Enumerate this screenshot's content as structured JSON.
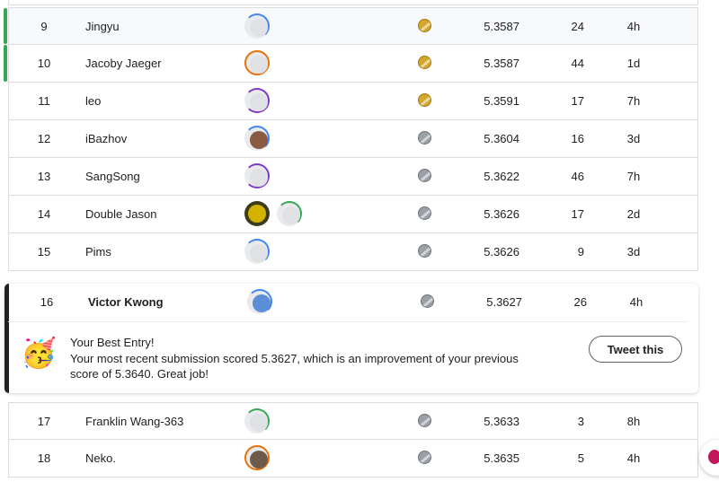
{
  "rows_top": [
    {
      "rank": "9",
      "name": "Jingyu",
      "medal": "gold",
      "score": "5.3587",
      "entries": "24",
      "last": "4h",
      "team_avatars": 1,
      "highlight": true,
      "indicator": "green",
      "ring": "blue"
    },
    {
      "rank": "10",
      "name": "Jacoby Jaeger",
      "medal": "gold",
      "score": "5.3587",
      "entries": "44",
      "last": "1d",
      "highlight": false,
      "indicator": "green",
      "ring": "orange"
    },
    {
      "rank": "11",
      "name": "leo",
      "medal": "gold",
      "score": "5.3591",
      "entries": "17",
      "last": "7h",
      "ring": "purple"
    },
    {
      "rank": "12",
      "name": "iBazhov",
      "medal": "silver",
      "score": "5.3604",
      "entries": "16",
      "last": "3d",
      "ring": "blue"
    },
    {
      "rank": "13",
      "name": "SangSong",
      "medal": "silver",
      "score": "5.3622",
      "entries": "46",
      "last": "7h",
      "ring": "purple"
    },
    {
      "rank": "14",
      "name": "Double Jason",
      "medal": "silver",
      "score": "5.3626",
      "entries": "17",
      "last": "2d",
      "ring": "green",
      "extra_avatar": true
    },
    {
      "rank": "15",
      "name": "Pims",
      "medal": "silver",
      "score": "5.3626",
      "entries": "9",
      "last": "3d",
      "ring": "blue"
    }
  ],
  "current_user": {
    "rank": "16",
    "name": "Victor Kwong",
    "medal": "silver",
    "score": "5.3627",
    "entries": "26",
    "last": "4h",
    "emoji": "🥳",
    "message_title": "Your Best Entry!",
    "message_body": "Your most recent submission scored 5.3627, which is an improvement of your previous score of 5.3640. Great job!",
    "tweet_label": "Tweet this"
  },
  "rows_bottom": [
    {
      "rank": "17",
      "name": "Franklin Wang-363",
      "medal": "silver",
      "score": "5.3633",
      "entries": "3",
      "last": "8h",
      "ring": "green"
    },
    {
      "rank": "18",
      "name": "Neko.",
      "medal": "silver",
      "score": "5.3635",
      "entries": "5",
      "last": "4h",
      "ring": "orange"
    }
  ],
  "colors": {
    "gold": "#d4a72c",
    "silver": "#9aa0a6",
    "indicator": "#34a853",
    "accent": "#4285f4"
  }
}
